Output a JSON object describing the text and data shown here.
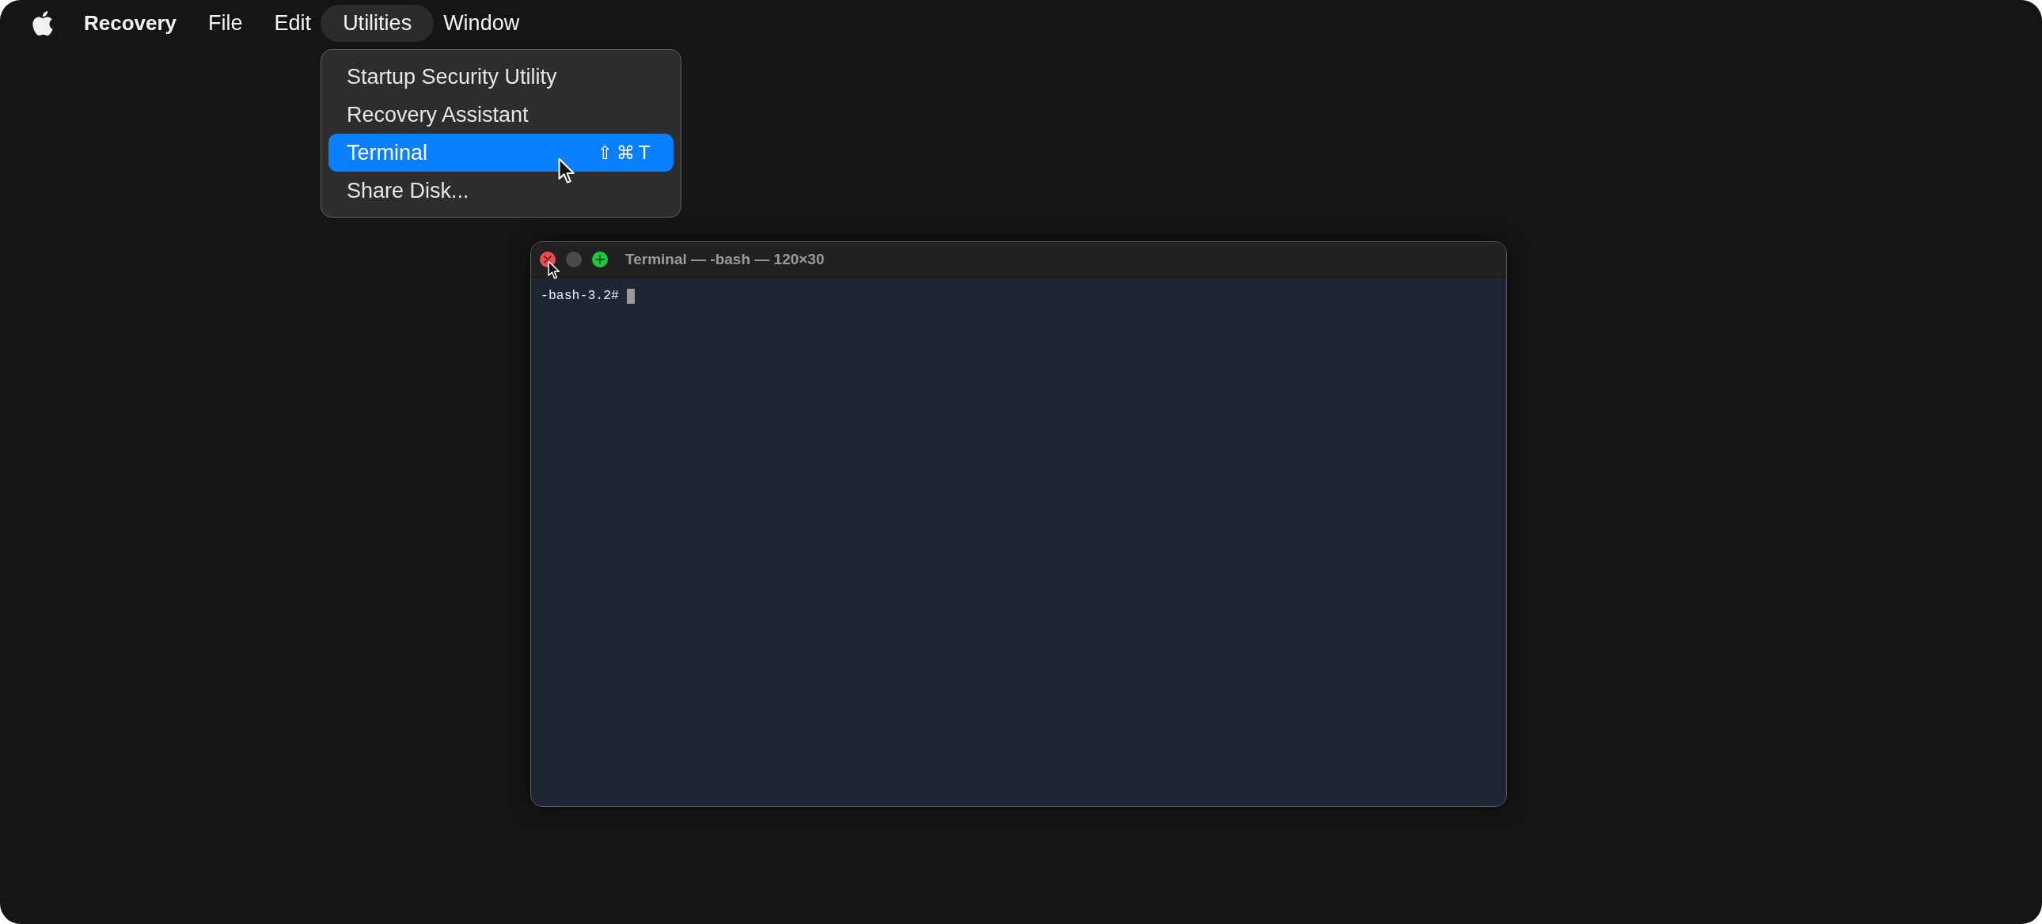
{
  "menu_bar": {
    "items": [
      {
        "label": "Recovery",
        "kind": "app",
        "selected": false
      },
      {
        "label": "File",
        "kind": "menu",
        "selected": false
      },
      {
        "label": "Edit",
        "kind": "menu",
        "selected": false
      },
      {
        "label": "Utilities",
        "kind": "menu",
        "selected": true
      },
      {
        "label": "Window",
        "kind": "menu",
        "selected": false
      }
    ]
  },
  "utilities_menu": {
    "items": [
      {
        "label": "Startup Security Utility",
        "selected": false
      },
      {
        "label": "Recovery Assistant",
        "selected": false
      },
      {
        "label": "Terminal",
        "shortcut": "⇧⌘T",
        "selected": true
      },
      {
        "label": "Share Disk...",
        "selected": false
      }
    ]
  },
  "terminal_window": {
    "title": "Terminal — -bash — 120×30",
    "buttons": [
      {
        "kind": "close",
        "disabled": false
      },
      {
        "kind": "minimize",
        "disabled": true
      },
      {
        "kind": "zoom",
        "disabled": false
      }
    ],
    "prompt": "-bash-3.2#"
  }
}
